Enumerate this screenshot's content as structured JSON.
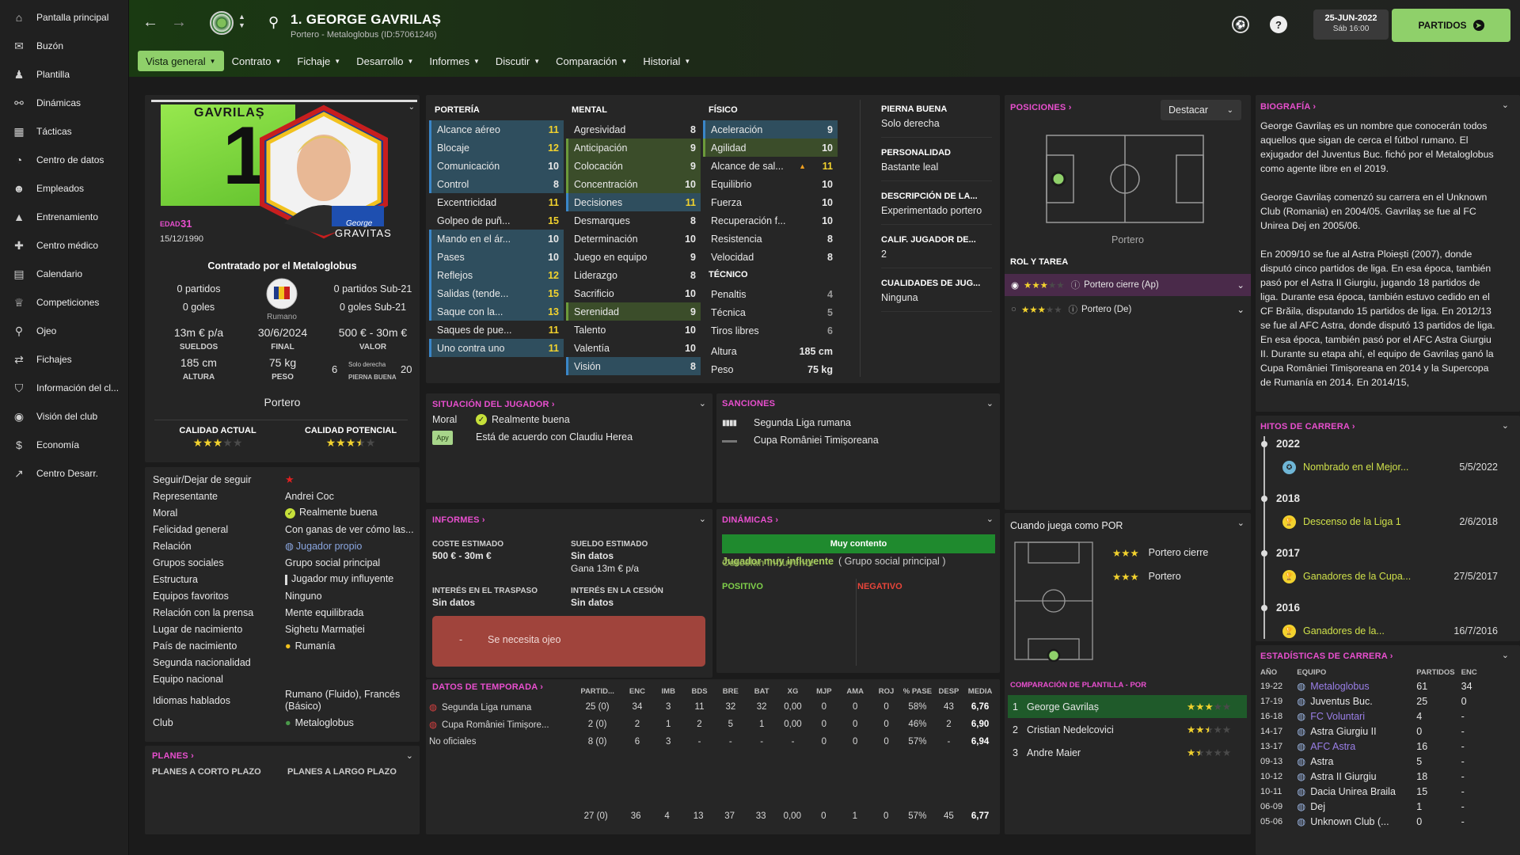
{
  "sidebar": {
    "items": [
      {
        "label": "Pantalla principal",
        "icon": "home-icon",
        "glyph": "⌂"
      },
      {
        "label": "Buzón",
        "icon": "inbox-icon",
        "glyph": "✉"
      },
      {
        "label": "Plantilla",
        "icon": "squad-icon",
        "glyph": "♟"
      },
      {
        "label": "Dinámicas",
        "icon": "dynamics-icon",
        "glyph": "⚯"
      },
      {
        "label": "Tácticas",
        "icon": "tactics-icon",
        "glyph": "▦"
      },
      {
        "label": "Centro de datos",
        "icon": "data-hub-icon",
        "glyph": "◔"
      },
      {
        "label": "Empleados",
        "icon": "staff-icon",
        "glyph": "☻"
      },
      {
        "label": "Entrenamiento",
        "icon": "training-icon",
        "glyph": "▲"
      },
      {
        "label": "Centro médico",
        "icon": "medical-icon",
        "glyph": "✚"
      },
      {
        "label": "Calendario",
        "icon": "calendar-icon",
        "glyph": "▤"
      },
      {
        "label": "Competiciones",
        "icon": "trophy-icon",
        "glyph": "♕"
      },
      {
        "label": "Ojeo",
        "icon": "scouting-icon",
        "glyph": "⚲"
      },
      {
        "label": "Fichajes",
        "icon": "transfers-icon",
        "glyph": "⇄"
      },
      {
        "label": "Información del cl...",
        "icon": "club-info-icon",
        "glyph": "⛉"
      },
      {
        "label": "Visión del club",
        "icon": "club-vision-icon",
        "glyph": "◉"
      },
      {
        "label": "Economía",
        "icon": "finances-icon",
        "glyph": "$"
      },
      {
        "label": "Centro Desarr.",
        "icon": "development-icon",
        "glyph": "↗"
      }
    ]
  },
  "header": {
    "title": "1. GEORGE GAVRILAȘ",
    "subtitle": "Portero - Metaloglobus (ID:57061246)",
    "fm": "FM",
    "help": "?",
    "date": "25-JUN-2022",
    "time": "Sáb 16:00",
    "continue": "PARTIDOS"
  },
  "tabs": [
    {
      "label": "Vista general",
      "active": true
    },
    {
      "label": "Contrato"
    },
    {
      "label": "Fichaje"
    },
    {
      "label": "Desarrollo"
    },
    {
      "label": "Informes"
    },
    {
      "label": "Discutir"
    },
    {
      "label": "Comparación"
    },
    {
      "label": "Historial"
    }
  ],
  "profile": {
    "shirt_name": "GAVRILAȘ",
    "shirt_number": "1",
    "age_label": "EDAD",
    "age": "31",
    "dob": "15/12/1990",
    "contract_title": "Contratado por el Metaloglobus",
    "matches": "0 partidos",
    "goals": "0 goles",
    "u21_matches": "0 partidos Sub-21",
    "u21_goals": "0 goles Sub-21",
    "nationality": "Rumano",
    "wage": "13m € p/a",
    "wage_label": "SUELDOS",
    "contract_end": "30/6/2024",
    "contract_end_label": "FINAL",
    "value": "500 € - 30m €",
    "value_label": "VALOR",
    "height": "185 cm",
    "height_label": "ALTURA",
    "weight": "75 kg",
    "weight_label": "PESO",
    "foot_left": "6",
    "foot_right": "20",
    "foot_text": "Solo derecha",
    "foot_label": "PIERNA BUENA",
    "position": "Portero",
    "ca_label": "CALIDAD ACTUAL",
    "ca_stars": 3,
    "pa_label": "CALIDAD POTENCIAL",
    "pa_stars": 3.5,
    "photo_caption_1": "George",
    "photo_caption_2": "GRAVITAS"
  },
  "info": [
    {
      "label": "Seguir/Dejar de seguir",
      "value": "",
      "icon": "star"
    },
    {
      "label": "Representante",
      "value": "Andrei Coc"
    },
    {
      "label": "Moral",
      "value": "Realmente buena",
      "icon": "check"
    },
    {
      "label": "Felicidad general",
      "value": "Con ganas de ver cómo las..."
    },
    {
      "label": "Relación",
      "value": "Jugador propio",
      "icon": "globe",
      "link": true
    },
    {
      "label": "Grupos sociales",
      "value": "Grupo social principal"
    },
    {
      "label": "Estructura",
      "value": "Jugador muy influyente",
      "icon": "bar"
    },
    {
      "label": "Equipos favoritos",
      "value": "Ninguno"
    },
    {
      "label": "Relación con la prensa",
      "value": "Mente equilibrada"
    },
    {
      "label": "Lugar de nacimiento",
      "value": "Sighetu Marmației"
    },
    {
      "label": "País de nacimiento",
      "value": "Rumanía",
      "icon": "flag"
    },
    {
      "label": "Segunda nacionalidad",
      "value": ""
    },
    {
      "label": "Equipo nacional",
      "value": ""
    },
    {
      "label": "Idiomas hablados",
      "value": "Rumano (Fluido), Francés (Básico)",
      "tall": true
    },
    {
      "label": "Club",
      "value": "Metaloglobus",
      "icon": "club"
    }
  ],
  "plans": {
    "title": "PLANES",
    "short": "PLANES A CORTO PLAZO",
    "long": "PLANES A LARGO PLAZO"
  },
  "attributes": {
    "gk": {
      "title": "PORTERÍA",
      "rows": [
        {
          "n": "Alcance aéreo",
          "v": "11",
          "h": "hl",
          "c": "y"
        },
        {
          "n": "Blocaje",
          "v": "12",
          "h": "hl",
          "c": "y"
        },
        {
          "n": "Comunicación",
          "v": "10",
          "h": "hl"
        },
        {
          "n": "Control",
          "v": "8",
          "h": "hl"
        },
        {
          "n": "Excentricidad",
          "v": "11",
          "c": "y"
        },
        {
          "n": "Golpeo de puñ...",
          "v": "15",
          "c": "y"
        },
        {
          "n": "Mando en el ár...",
          "v": "10",
          "h": "hl"
        },
        {
          "n": "Pases",
          "v": "10",
          "h": "hl"
        },
        {
          "n": "Reflejos",
          "v": "12",
          "h": "hl",
          "c": "y"
        },
        {
          "n": "Salidas (tende...",
          "v": "15",
          "h": "hl",
          "c": "y"
        },
        {
          "n": "Saque con la...",
          "v": "13",
          "h": "hl",
          "c": "y"
        },
        {
          "n": "Saques de pue...",
          "v": "11",
          "c": "y"
        },
        {
          "n": "Uno contra uno",
          "v": "11",
          "h": "hl",
          "c": "y"
        }
      ]
    },
    "mental": {
      "title": "MENTAL",
      "rows": [
        {
          "n": "Agresividad",
          "v": "8"
        },
        {
          "n": "Anticipación",
          "v": "9",
          "h": "hg"
        },
        {
          "n": "Colocación",
          "v": "9",
          "h": "hg"
        },
        {
          "n": "Concentración",
          "v": "10",
          "h": "hg"
        },
        {
          "n": "Decisiones",
          "v": "11",
          "h": "hl",
          "c": "y"
        },
        {
          "n": "Desmarques",
          "v": "8"
        },
        {
          "n": "Determinación",
          "v": "10"
        },
        {
          "n": "Juego en equipo",
          "v": "9"
        },
        {
          "n": "Liderazgo",
          "v": "8"
        },
        {
          "n": "Sacrificio",
          "v": "10"
        },
        {
          "n": "Serenidad",
          "v": "9",
          "h": "hg"
        },
        {
          "n": "Talento",
          "v": "10"
        },
        {
          "n": "Valentía",
          "v": "10"
        },
        {
          "n": "Visión",
          "v": "8",
          "h": "hl"
        }
      ]
    },
    "physical": {
      "title": "FÍSICO",
      "rows": [
        {
          "n": "Aceleración",
          "v": "9",
          "h": "hl"
        },
        {
          "n": "Agilidad",
          "v": "10",
          "h": "hg"
        },
        {
          "n": "Alcance de sal...",
          "v": "11",
          "c": "y",
          "warn": true
        },
        {
          "n": "Equilibrio",
          "v": "10"
        },
        {
          "n": "Fuerza",
          "v": "10"
        },
        {
          "n": "Recuperación f...",
          "v": "10"
        },
        {
          "n": "Resistencia",
          "v": "8"
        },
        {
          "n": "Velocidad",
          "v": "8"
        }
      ]
    },
    "technical": {
      "title": "TÉCNICO",
      "rows": [
        {
          "n": "Penaltis",
          "v": "4",
          "c": "g"
        },
        {
          "n": "Técnica",
          "v": "5",
          "c": "g"
        },
        {
          "n": "Tiros libres",
          "v": "6",
          "c": "g"
        }
      ]
    },
    "height_label": "Altura",
    "height": "185 cm",
    "weight_label": "Peso",
    "weight": "75 kg"
  },
  "traits": [
    {
      "label": "PIERNA BUENA",
      "value": "Solo derecha"
    },
    {
      "label": "PERSONALIDAD",
      "value": "Bastante leal"
    },
    {
      "label": "DESCRIPCIÓN DE LA...",
      "value": "Experimentado portero"
    },
    {
      "label": "CALIF. JUGADOR DE...",
      "value": "2"
    },
    {
      "label": "CUALIDADES DE JUG...",
      "value": "Ninguna"
    }
  ],
  "positions": {
    "title": "POSICIONES",
    "highlight": "Destacar",
    "caption": "Portero",
    "role_title": "ROL Y TAREA",
    "roles": [
      {
        "name": "Portero cierre (Ap)",
        "stars": 3,
        "selected": true
      },
      {
        "name": "Portero (De)",
        "stars": 3,
        "selected": false
      }
    ]
  },
  "bio": {
    "title": "BIOGRAFÍA",
    "paragraphs": [
      "George Gavrilaș es un nombre que conocerán todos aquellos que sigan de cerca el fútbol rumano. El exjugador del Juventus Buc. fichó por el Metaloglobus como agente libre en el 2019.",
      "George Gavrilaș comenzó su carrera en el Unknown Club (Romania) en 2004/05. Gavrilaș se fue al FC Unirea Dej en 2005/06.",
      "En 2009/10 se fue al Astra Ploiești (2007), donde disputó cinco partidos de liga. En esa época, también pasó por el Astra II Giurgiu, jugando 18 partidos de liga. Durante esa época, también estuvo cedido en el CF Brăila, disputando 15 partidos de liga. En 2012/13 se fue al AFC Astra, donde disputó 13 partidos de liga. En esa época, también pasó por el AFC Astra Giurgiu II. Durante su etapa ahí, el equipo de Gavrilaș ganó la Cupa României Timișoreana en 2014 y la Supercopa de Rumanía en 2014. En 2014/15,"
    ]
  },
  "milestones": {
    "title": "HITOS DE CARRERA",
    "items": [
      {
        "year": "2022",
        "text": "Nombrado en el Mejor...",
        "date": "5/5/2022",
        "icon": "award-icon"
      },
      {
        "year": "2018",
        "text": "Descenso de la Liga 1",
        "date": "2/6/2018",
        "icon": "relegation-icon"
      },
      {
        "year": "2017",
        "text": "Ganadores de la Cupa...",
        "date": "27/5/2017",
        "icon": "trophy-icon"
      },
      {
        "year": "2016",
        "text": "Ganadores de la...",
        "date": "16/7/2016",
        "icon": "trophy-icon"
      }
    ]
  },
  "career": {
    "title": "ESTADÍSTICAS DE CARRERA",
    "headers": [
      "AÑO",
      "EQUIPO",
      "PARTIDOS",
      "ENC"
    ],
    "rows": [
      {
        "y": "19-22",
        "t": "Metaloglobus",
        "p": "61",
        "e": "34",
        "link": true
      },
      {
        "y": "17-19",
        "t": "Juventus Buc.",
        "p": "25",
        "e": "0"
      },
      {
        "y": "16-18",
        "t": "FC Voluntari",
        "p": "4",
        "e": "-",
        "link": true
      },
      {
        "y": "14-17",
        "t": "Astra Giurgiu II",
        "p": "0",
        "e": "-"
      },
      {
        "y": "13-17",
        "t": "AFC Astra",
        "p": "16",
        "e": "-",
        "link": true
      },
      {
        "y": "09-13",
        "t": "Astra",
        "p": "5",
        "e": "-"
      },
      {
        "y": "10-12",
        "t": "Astra II Giurgiu",
        "p": "18",
        "e": "-"
      },
      {
        "y": "10-11",
        "t": "Dacia Unirea Braila",
        "p": "15",
        "e": "-"
      },
      {
        "y": "06-09",
        "t": "Dej",
        "p": "1",
        "e": "-"
      },
      {
        "y": "05-06",
        "t": "Unknown Club (...",
        "p": "0",
        "e": "-"
      }
    ]
  },
  "situation": {
    "title": "SITUACIÓN DEL JUGADOR",
    "moral_label": "Moral",
    "moral": "Realmente buena",
    "apy": "Apy",
    "agree": "Está de acuerdo con Claudiu Herea"
  },
  "sanctions": {
    "title": "SANCIONES",
    "items": [
      "Segunda Liga rumana",
      "Cupa României Timișoreana"
    ]
  },
  "reports": {
    "title": "INFORMES",
    "cost_label": "COSTE ESTIMADO",
    "cost": "500 € - 30m €",
    "wage_label": "SUELDO ESTIMADO",
    "wage": "Sin datos",
    "wage2": "Gana 13m € p/a",
    "transfer_label": "INTERÉS EN EL TRASPASO",
    "transfer": "Sin datos",
    "loan_label": "INTERÉS EN LA CESIÓN",
    "loan": "Sin datos",
    "scout_dash": "-",
    "scout": "Se necesita ojeo"
  },
  "dynamics": {
    "title": "DINÁMICAS",
    "status": "Muy contento",
    "overlap1": "Jugador muy influyente",
    "overlap2": "Grupo social principal",
    "overlap3": "Corcelan influyente",
    "positive": "POSITIVO",
    "negative": "NEGATIVO"
  },
  "season": {
    "title": "DATOS DE TEMPORADA",
    "headers": [
      "PARTID...",
      "ENC",
      "IMB",
      "BDS",
      "BRE",
      "BAT",
      "XG",
      "MJP",
      "AMA",
      "ROJ",
      "% PASE",
      "DESP",
      "MEDIA"
    ],
    "rows": [
      {
        "comp": "Segunda Liga rumana",
        "vals": [
          "25 (0)",
          "34",
          "3",
          "11",
          "32",
          "32",
          "0,00",
          "0",
          "0",
          "0",
          "58%",
          "43",
          "6,76"
        ]
      },
      {
        "comp": "Cupa României Timișore...",
        "vals": [
          "2 (0)",
          "2",
          "1",
          "2",
          "5",
          "1",
          "0,00",
          "0",
          "0",
          "0",
          "46%",
          "2",
          "6,90"
        ]
      },
      {
        "comp": "No oficiales",
        "vals": [
          "8 (0)",
          "6",
          "3",
          "-",
          "-",
          "-",
          "-",
          "0",
          "0",
          "0",
          "57%",
          "-",
          "6,94"
        ]
      }
    ],
    "totals": [
      "27 (0)",
      "36",
      "4",
      "13",
      "37",
      "33",
      "0,00",
      "0",
      "1",
      "0",
      "57%",
      "45",
      "6,77"
    ]
  },
  "as_gk": {
    "title": "Cuando juega como POR",
    "roles": [
      {
        "name": "Portero cierre",
        "stars": 3
      },
      {
        "name": "Portero",
        "stars": 3
      }
    ],
    "cmp_title": "COMPARACIÓN DE PLANTILLA - POR",
    "cmp": [
      {
        "n": "1",
        "name": "George Gavrilaș",
        "stars": 3
      },
      {
        "n": "2",
        "name": "Cristian Nedelcovici",
        "stars": 2.5
      },
      {
        "n": "3",
        "name": "Andre Maier",
        "stars": 1.5
      }
    ]
  },
  "colors": {
    "accent": "#8fd06a",
    "magenta": "#e94fcf",
    "blue_hl": "#2f4e5e",
    "green_hl": "#3b4d2a",
    "star": "#f2d22e"
  }
}
